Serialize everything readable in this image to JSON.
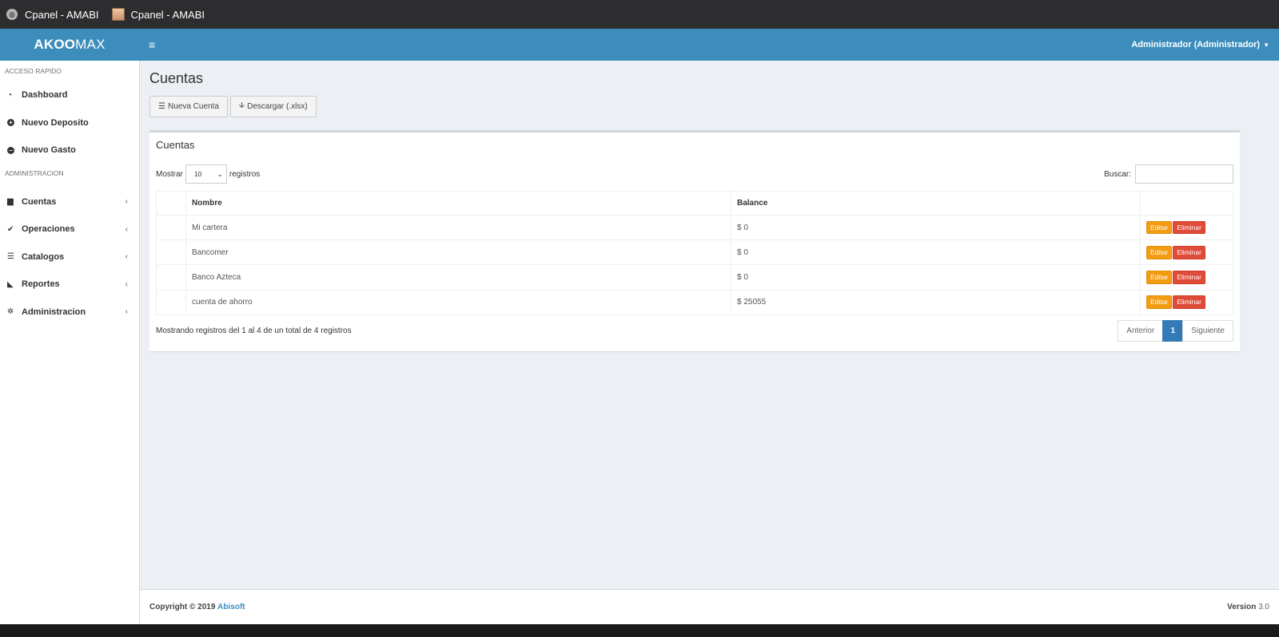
{
  "titlebar": {
    "tabs": [
      {
        "label": "Cpanel - AMABI",
        "icon": "globe-icon"
      },
      {
        "label": "Cpanel - AMABI",
        "icon": "favicon-icon"
      }
    ]
  },
  "header": {
    "logo_bold": "AKOO",
    "logo_rest": "MAX",
    "menu_icon": "hamburger-icon",
    "user": "Administrador (Administrador)"
  },
  "sidebar": {
    "section1": "ACCESO RAPIDO",
    "quick": [
      {
        "label": "Dashboard",
        "icon": "dashboard-icon"
      },
      {
        "label": "Nuevo Deposito",
        "icon": "plus-circle-icon"
      },
      {
        "label": "Nuevo Gasto",
        "icon": "minus-circle-icon"
      }
    ],
    "section2": "ADMINISTRACION",
    "admin": [
      {
        "label": "Cuentas",
        "icon": "briefcase-icon"
      },
      {
        "label": "Operaciones",
        "icon": "check-icon"
      },
      {
        "label": "Catalogos",
        "icon": "database-icon"
      },
      {
        "label": "Reportes",
        "icon": "area-chart-icon"
      },
      {
        "label": "Administracion",
        "icon": "gear-icon"
      }
    ]
  },
  "page": {
    "title": "Cuentas",
    "btn_new": "Nueva Cuenta",
    "btn_download": "Descargar (.xlsx)"
  },
  "box": {
    "title": "Cuentas",
    "show_prefix": "Mostrar",
    "show_value": "10",
    "show_suffix": "registros",
    "search_label": "Buscar:",
    "search_value": "",
    "columns": [
      "",
      "Nombre",
      "Balance",
      ""
    ],
    "rows": [
      {
        "name": "Mi cartera",
        "balance": "$ 0"
      },
      {
        "name": "Bancomer",
        "balance": "$ 0"
      },
      {
        "name": "Banco Azteca",
        "balance": "$ 0"
      },
      {
        "name": "cuenta de ahorro",
        "balance": "$ 25055"
      }
    ],
    "edit_label": "Editar",
    "delete_label": "Eliminar",
    "info": "Mostrando registros del 1 al 4 de un total de 4 registros",
    "prev": "Anterior",
    "page": "1",
    "next": "Siguiente"
  },
  "footer": {
    "copy": "Copyright © 2019",
    "brand": "Abisoft",
    "version_label": "Version",
    "version": "3.0"
  },
  "colors": {
    "header": "#3c8dbc",
    "warning": "#f39c12",
    "danger": "#dd4b39",
    "primary": "#337ab7"
  }
}
